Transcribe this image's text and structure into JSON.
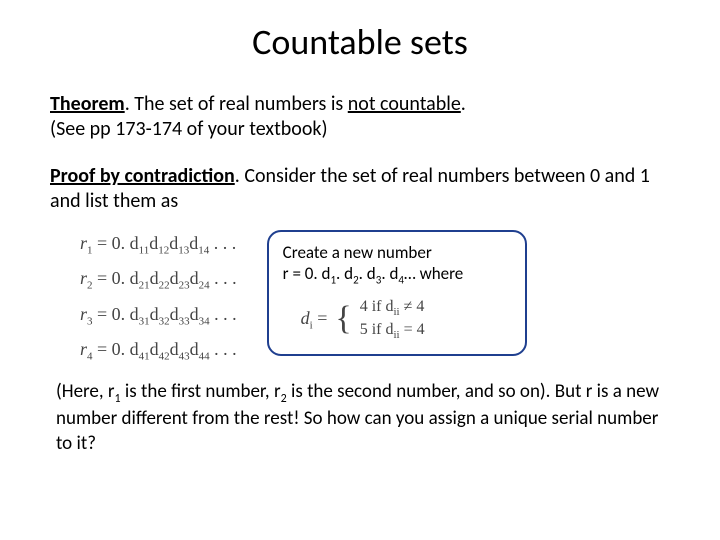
{
  "title": "Countable sets",
  "theorem_label": "Theorem",
  "theorem_text_a": ". The set of real numbers is ",
  "theorem_text_b": "not countable",
  "theorem_text_c": ".",
  "see_ref": "(See pp 173-174 of your textbook)",
  "proof_label": "Proof by contradiction",
  "proof_text": ". Consider the set of real numbers between 0 and 1 and list them as",
  "rows": {
    "r1a": "r",
    "r1s": "1",
    "r1b": " = 0. d",
    "r1c": "11",
    "r1d": "d",
    "r1e": "12",
    "r1f": "d",
    "r1g": "13",
    "r1h": "d",
    "r1i": "14",
    "r1j": " . . .",
    "r2a": "r",
    "r2s": "2",
    "r2b": " = 0. d",
    "r2c": "21",
    "r2d": "d",
    "r2e": "22",
    "r2f": "d",
    "r2g": "23",
    "r2h": "d",
    "r2i": "24",
    "r2j": " . . .",
    "r3a": "r",
    "r3s": "3",
    "r3b": " = 0. d",
    "r3c": "31",
    "r3d": "d",
    "r3e": "32",
    "r3f": "d",
    "r3g": "33",
    "r3h": "d",
    "r3i": "34",
    "r3j": " . . .",
    "r4a": "r",
    "r4s": "4",
    "r4b": " = 0. d",
    "r4c": "41",
    "r4d": "d",
    "r4e": "42",
    "r4f": "d",
    "r4g": "43",
    "r4h": "d",
    "r4i": "44",
    "r4j": " . . ."
  },
  "callout_line1": "Create a new number",
  "callout_line2a": "r = 0. d",
  "callout_line2s1": "1",
  "callout_line2b": ". d",
  "callout_line2s2": "2",
  "callout_line2c": ". d",
  "callout_line2s3": "3",
  "callout_line2d": ". d",
  "callout_line2s4": "4",
  "callout_line2e": "… where",
  "di_lhs_a": "d",
  "di_lhs_s": "i",
  "di_lhs_b": " = ",
  "di_case1": "4 if d",
  "di_case1s": "ii",
  "di_case1b": " ≠ 4",
  "di_case2": "5 if d",
  "di_case2s": "ii",
  "di_case2b": " = 4",
  "para3a": "(Here, r",
  "para3s1": "1",
  "para3b": " is the first number, r",
  "para3s2": "2",
  "para3c": " is the second number, and so on). But r is a new number different from the rest! So how can you assign a unique serial number to it?"
}
